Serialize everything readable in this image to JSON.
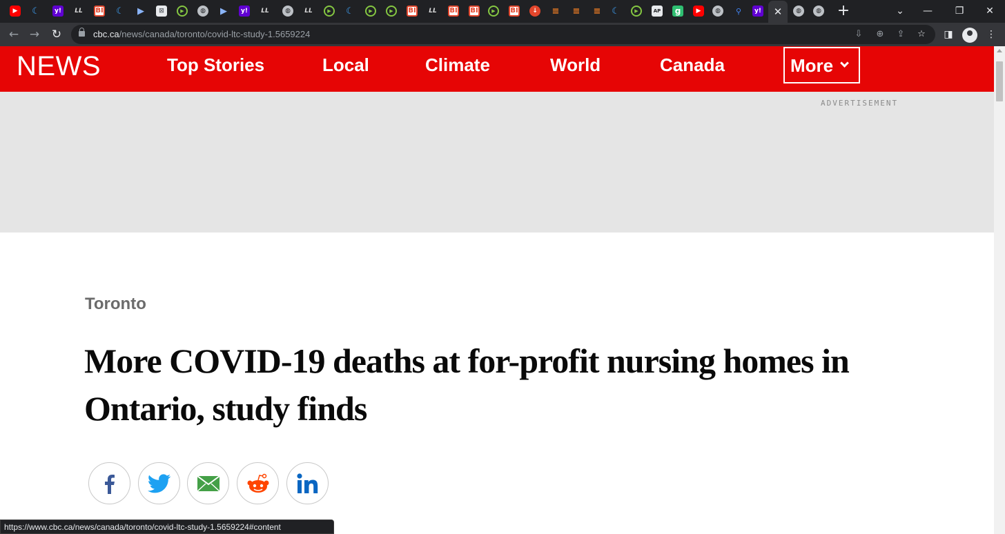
{
  "browser": {
    "url_host": "cbc.ca",
    "url_path": "/news/canada/toronto/covid-ltc-study-1.5659224",
    "active_tab_close": "✕",
    "new_tab": "+",
    "status_url": "https://www.cbc.ca/news/canada/toronto/covid-ltc-study-1.5659224#content",
    "tab_icons": [
      "youtube-icon",
      "vpn-shield-icon",
      "yahoo-icon",
      "medium-icon",
      "business-insider-icon",
      "vpn-shield-icon",
      "play-arrow-icon",
      "document-icon",
      "rumble-icon",
      "globe-icon",
      "play-arrow-icon",
      "yahoo-icon",
      "medium-icon",
      "globe-icon",
      "medium-icon",
      "rumble-icon",
      "vpn-shield-icon",
      "rumble-icon",
      "rumble-icon",
      "business-insider-icon",
      "medium-icon",
      "business-insider-icon",
      "business-insider-icon",
      "rumble-icon",
      "business-insider-icon",
      "reddit-alt-icon",
      "bookmark-icon",
      "bookmark-icon",
      "bookmark-icon",
      "vpn-shield-icon",
      "rumble-icon",
      "ap-icon",
      "g-icon",
      "youtube-icon",
      "globe-icon",
      "search-icon",
      "yahoo-icon",
      "close-icon",
      "globe-icon",
      "globe-icon"
    ]
  },
  "header": {
    "logo": "NEWS",
    "nav": [
      "Top Stories",
      "Local",
      "Climate",
      "World",
      "Canada"
    ],
    "more": "More"
  },
  "ad": {
    "label": "ADVERTISEMENT"
  },
  "article": {
    "section": "Toronto",
    "headline": "More COVID-19 deaths at for-profit nursing homes in Ontario, study finds"
  },
  "share": [
    "facebook",
    "twitter",
    "email",
    "reddit",
    "linkedin"
  ]
}
